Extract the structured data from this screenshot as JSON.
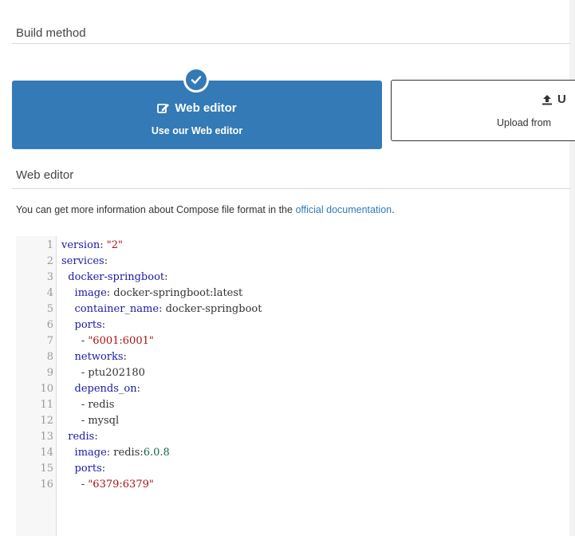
{
  "sections": {
    "build_method": "Build method",
    "web_editor": "Web editor"
  },
  "build_options": {
    "web_editor": {
      "title": "Web editor",
      "subtitle": "Use our Web editor",
      "selected": true
    },
    "upload": {
      "title": "U",
      "subtitle": "Upload from",
      "selected": false
    }
  },
  "info": {
    "prefix": "You can get more information about Compose file format in the ",
    "link": "official documentation",
    "suffix": "."
  },
  "editor": {
    "lines": [
      {
        "n": "1",
        "key": "version",
        "rest": ": ",
        "val": "\"2\"",
        "type": "s",
        "indent": ""
      },
      {
        "n": "2",
        "key": "services",
        "rest": ":",
        "val": "",
        "type": "",
        "indent": ""
      },
      {
        "n": "3",
        "key": "docker-springboot",
        "rest": ":",
        "val": "",
        "type": "",
        "indent": "  "
      },
      {
        "n": "4",
        "key": "image",
        "rest": ": docker-springboot:latest",
        "val": "",
        "type": "",
        "indent": "    "
      },
      {
        "n": "5",
        "key": "container_name",
        "rest": ": docker-springboot",
        "val": "",
        "type": "",
        "indent": "    "
      },
      {
        "n": "6",
        "key": "ports",
        "rest": ":",
        "val": "",
        "type": "",
        "indent": "    "
      },
      {
        "n": "7",
        "key": "",
        "rest": "- ",
        "val": "\"6001:6001\"",
        "type": "s",
        "indent": "      "
      },
      {
        "n": "8",
        "key": "networks",
        "rest": ":",
        "val": "",
        "type": "",
        "indent": "    "
      },
      {
        "n": "9",
        "key": "",
        "rest": "- ptu202180",
        "val": "",
        "type": "",
        "indent": "      "
      },
      {
        "n": "10",
        "key": "depends_on",
        "rest": ":",
        "val": "",
        "type": "",
        "indent": "    "
      },
      {
        "n": "11",
        "key": "",
        "rest": "- redis",
        "val": "",
        "type": "",
        "indent": "      "
      },
      {
        "n": "12",
        "key": "",
        "rest": "- mysql",
        "val": "",
        "type": "",
        "indent": "      "
      },
      {
        "n": "13",
        "key": "redis",
        "rest": ":",
        "val": "",
        "type": "",
        "indent": "  "
      },
      {
        "n": "14",
        "key": "image",
        "rest": ": redis:",
        "val": "6.0.8",
        "type": "n",
        "indent": "    "
      },
      {
        "n": "15",
        "key": "ports",
        "rest": ":",
        "val": "",
        "type": "",
        "indent": "    "
      },
      {
        "n": "16",
        "key": "",
        "rest": "- ",
        "val": "\"6379:6379\"",
        "type": "s",
        "indent": "      "
      }
    ]
  },
  "colors": {
    "accent": "#337ab7",
    "key": "#1a1aa6",
    "string": "#aa1111",
    "number": "#116644"
  },
  "icons": {
    "selected": "check-circle-icon",
    "web_editor": "edit-icon",
    "upload": "upload-icon"
  }
}
